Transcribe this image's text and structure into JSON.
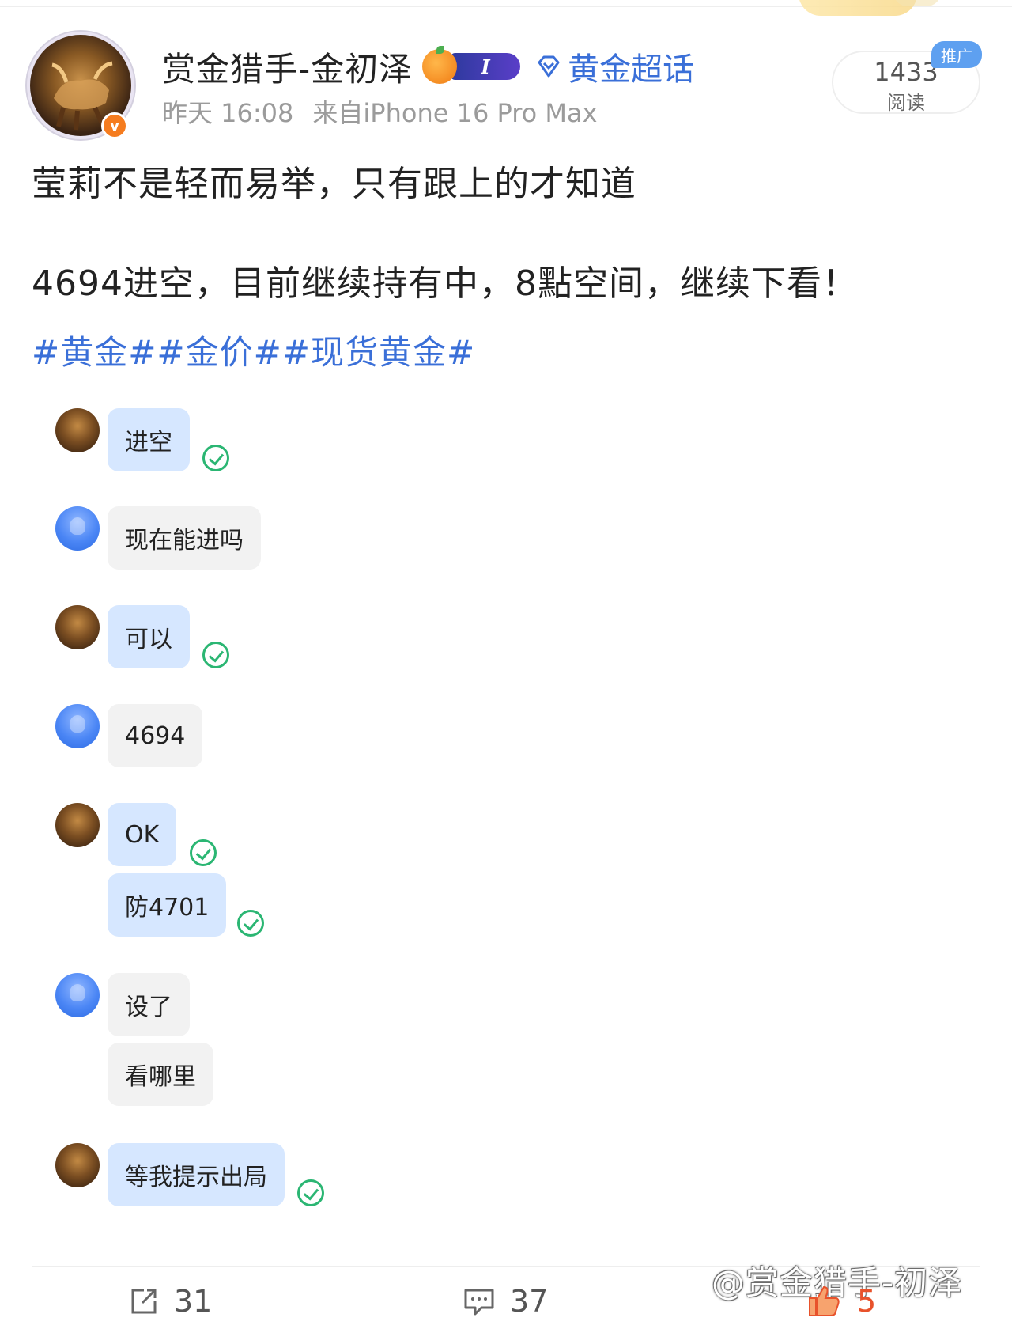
{
  "post": {
    "author": "赏金猎手-金初泽",
    "level_badge": "I",
    "supertopic": "黄金超话",
    "time": "昨天 16:08",
    "source": "来自iPhone 16 Pro Max",
    "read_count": "1433",
    "read_label": "阅读",
    "promo_tag": "推广",
    "text_line_1": "莹莉不是轻而易举，只有跟上的才知道",
    "text_line_2": "4694进空，目前继续持有中，8點空间，继续下看！",
    "hashtags": "#黄金##金价##现货黄金#"
  },
  "chat": {
    "messages": [
      {
        "from": "me",
        "text": "进空",
        "read": true
      },
      {
        "from": "them",
        "text": "现在能进吗",
        "read": false
      },
      {
        "from": "me",
        "text": "可以",
        "read": true
      },
      {
        "from": "them",
        "text": "4694",
        "read": false
      },
      {
        "from": "me",
        "text": "OK",
        "read": true
      },
      {
        "from": "me",
        "text": "防4701",
        "read": true
      },
      {
        "from": "them",
        "text": "设了",
        "read": false
      },
      {
        "from": "them",
        "text": "看哪里",
        "read": false
      },
      {
        "from": "me",
        "text": "等我提示出局",
        "read": true
      }
    ]
  },
  "actions": {
    "share_count": "31",
    "comment_count": "37",
    "like_count": "5"
  },
  "watermark": "@赏金猎手-初泽",
  "colors": {
    "link_blue": "#3a6fd8",
    "my_bubble": "#d6e7ff",
    "their_bubble": "#f2f2f2",
    "check_green": "#2bb673",
    "like_orange": "#e8522b",
    "verified_orange": "#f57c1f"
  },
  "icons": {
    "verified": "verified-v-icon",
    "supertopic": "diamond-icon",
    "share": "share-icon",
    "comment": "comment-icon",
    "like": "thumbs-up-icon",
    "read_receipt": "check-circle-icon"
  }
}
